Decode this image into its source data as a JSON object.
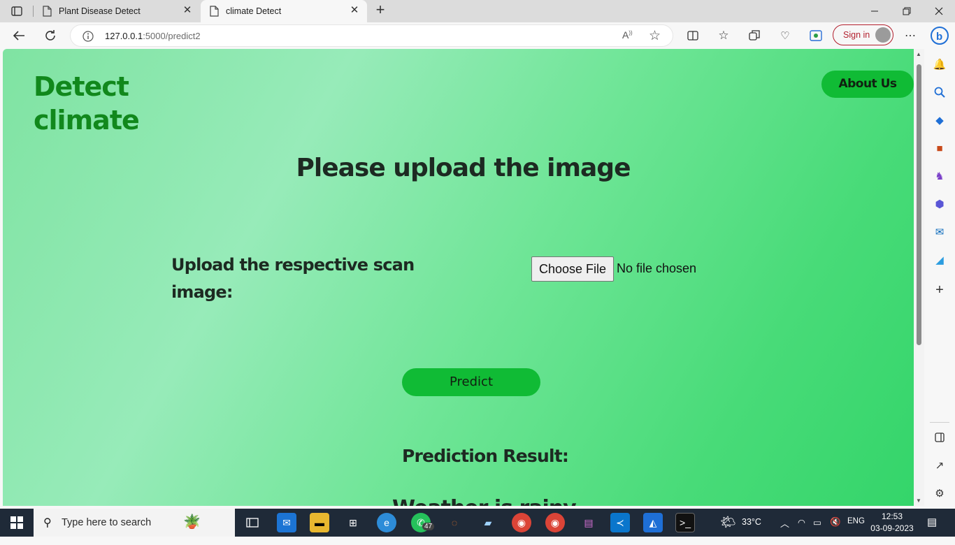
{
  "browser": {
    "tabs": [
      {
        "title": "Plant Disease Detect",
        "active": false
      },
      {
        "title": "climate Detect",
        "active": true
      }
    ],
    "address": {
      "host": "127.0.0.1",
      "rest": ":5000/predict2"
    },
    "signin_label": "Sign in"
  },
  "page": {
    "brand_line1": "Detect",
    "brand_line2": "climate",
    "about_button": "About Us",
    "heading": "Please upload the image",
    "upload_label": "Upload the respective scan image:",
    "choose_file": "Choose File",
    "no_file": "No file chosen",
    "predict_button": "Predict",
    "result_label": "Prediction Result:",
    "cut_text": "Weather is rainy"
  },
  "taskbar": {
    "search_placeholder": "Type here to search",
    "whatsapp_badge": "47",
    "weather": "33°C",
    "language": "ENG",
    "time": "12:53",
    "date": "03-09-2023"
  },
  "colors": {
    "brand": "#11881c",
    "button": "#10bb35",
    "signin": "#b21f2d"
  }
}
